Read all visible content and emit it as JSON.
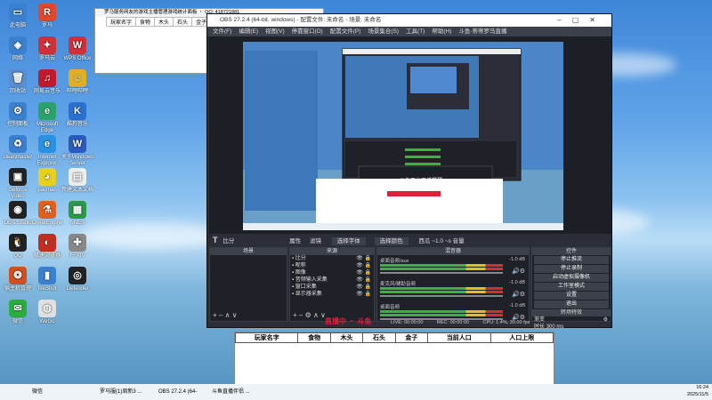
{
  "desktop_icons": [
    {
      "label": "此电脑",
      "c": "#3a80d0",
      "g": "▭"
    },
    {
      "label": "罗马",
      "c": "#e2462b",
      "g": "R"
    },
    {
      "label": "网络",
      "c": "#3a80d0",
      "g": "◈"
    },
    {
      "label": "罗马云",
      "c": "#d0303a",
      "g": "✦"
    },
    {
      "label": "WPS Office",
      "c": "#d0303a",
      "g": "W"
    },
    {
      "label": "回收站",
      "c": "#5a8ed0",
      "g": "🗑"
    },
    {
      "label": "网易云音乐",
      "c": "#c21a2a",
      "g": "♫"
    },
    {
      "label": "哔哩哔哩",
      "c": "#e0b020",
      "g": "☺"
    },
    {
      "label": "控制面板",
      "c": "#3a80d0",
      "g": "⚙"
    },
    {
      "label": "Microsoft Edge",
      "c": "#2aa36b",
      "g": "e"
    },
    {
      "label": "酷狗音乐",
      "c": "#2a70d0",
      "g": "K"
    },
    {
      "label": "cleanmaster",
      "c": "#3a80d0",
      "g": "♻"
    },
    {
      "label": "Internet Explorer",
      "c": "#2a90e0",
      "g": "e"
    },
    {
      "label": "关于Windows Server",
      "c": "#2a5bbd",
      "g": "W"
    },
    {
      "label": "Geforce Video",
      "c": "#222",
      "g": "▣"
    },
    {
      "label": "pacman",
      "c": "#e8d020",
      "g": "◕"
    },
    {
      "label": "新建文本文档",
      "c": "#eee",
      "g": "▤"
    },
    {
      "label": "OBS Studio",
      "c": "#222",
      "g": "◉"
    },
    {
      "label": "CheatEngine",
      "c": "#e06020",
      "g": "⚗"
    },
    {
      "label": "SNES",
      "c": "#2a9a4a",
      "g": "▦"
    },
    {
      "label": "QQ",
      "c": "#222",
      "g": "🐧"
    },
    {
      "label": "极速浏览器",
      "c": "#c03020",
      "g": "◐"
    },
    {
      "label": "FFXIV",
      "c": "#888",
      "g": "✚"
    },
    {
      "label": "宿主机管理",
      "c": "#d05020",
      "g": "❂"
    },
    {
      "label": "fireShot",
      "c": "#3a80d0",
      "g": "▮"
    },
    {
      "label": "Defender",
      "c": "#222",
      "g": "◎"
    },
    {
      "label": "微信",
      "c": "#2aae40",
      "g": "✉"
    },
    {
      "label": "WeGo",
      "c": "#e0e0e0",
      "g": "◍"
    }
  ],
  "mini_window": {
    "title": "罗马服务网友的游戏主播管理游戏统计面板 ・ QQ: 418721881",
    "headers": [
      "玩家名字",
      "食物",
      "木头",
      "石头",
      "金子",
      "当前人口",
      "人口上限"
    ]
  },
  "obs": {
    "title": "OBS 27.2.4 (64-bit, windows) - 配置文件: 未命名 - 场景: 未命名",
    "menu": [
      "文件(F)",
      "编辑(E)",
      "视图(V)",
      "停靠窗口(D)",
      "配置文件(P)",
      "场景集合(S)",
      "工具(T)",
      "帮助(H)",
      "斗鱼·蒂蒂罗马直播"
    ],
    "source_bar": {
      "name": "比分",
      "props": "属性",
      "filters": "滤镜",
      "font": "选择字体",
      "color": "选择颜色",
      "extra": "西瓜 ~1.0 ~s  音量"
    },
    "scenes_header": "场景",
    "sources_header": "来源",
    "mixer_header": "混音器",
    "transitions_header": "转场特效",
    "controls_header": "控件",
    "sources": [
      "比分",
      "昵称",
      "图像",
      "音频输入采集",
      "窗口采集",
      "显示器采集"
    ],
    "mixer": [
      {
        "label": "桌面音频/aux",
        "db": "-1.0 dB"
      },
      {
        "label": "麦克风/辅助音频",
        "db": "-1.0 dB"
      },
      {
        "label": "桌面音频",
        "db": "-1.0 dB"
      }
    ],
    "controls": [
      "停止推流",
      "停止录制",
      "启动虚拟摄像机",
      "工作室模式",
      "设置",
      "退出"
    ],
    "transition": {
      "name": "渐变",
      "duration_label": "时长",
      "duration": "300 ms"
    },
    "status": {
      "live": "LIVE: 00:00:00",
      "rec": "REC: 00:00:00",
      "cpu": "CPU: 1.4%, 30.00 fps"
    },
    "preview_overlay": "斗鱼平台开播提醒",
    "red_text": "直播中 ・ 斗鱼"
  },
  "big_table": {
    "headers": [
      "玩家名字",
      "食物",
      "木头",
      "石头",
      "金子",
      "当前人口",
      "人口上限"
    ]
  },
  "taskbar": {
    "items": [
      "微信",
      "罗马服(1)周新3 ...",
      "OBS 27.2.4 (64-bi...",
      "斗鱼直播伴侣 ..."
    ],
    "time": "16:24",
    "date": "2025/11/5"
  }
}
